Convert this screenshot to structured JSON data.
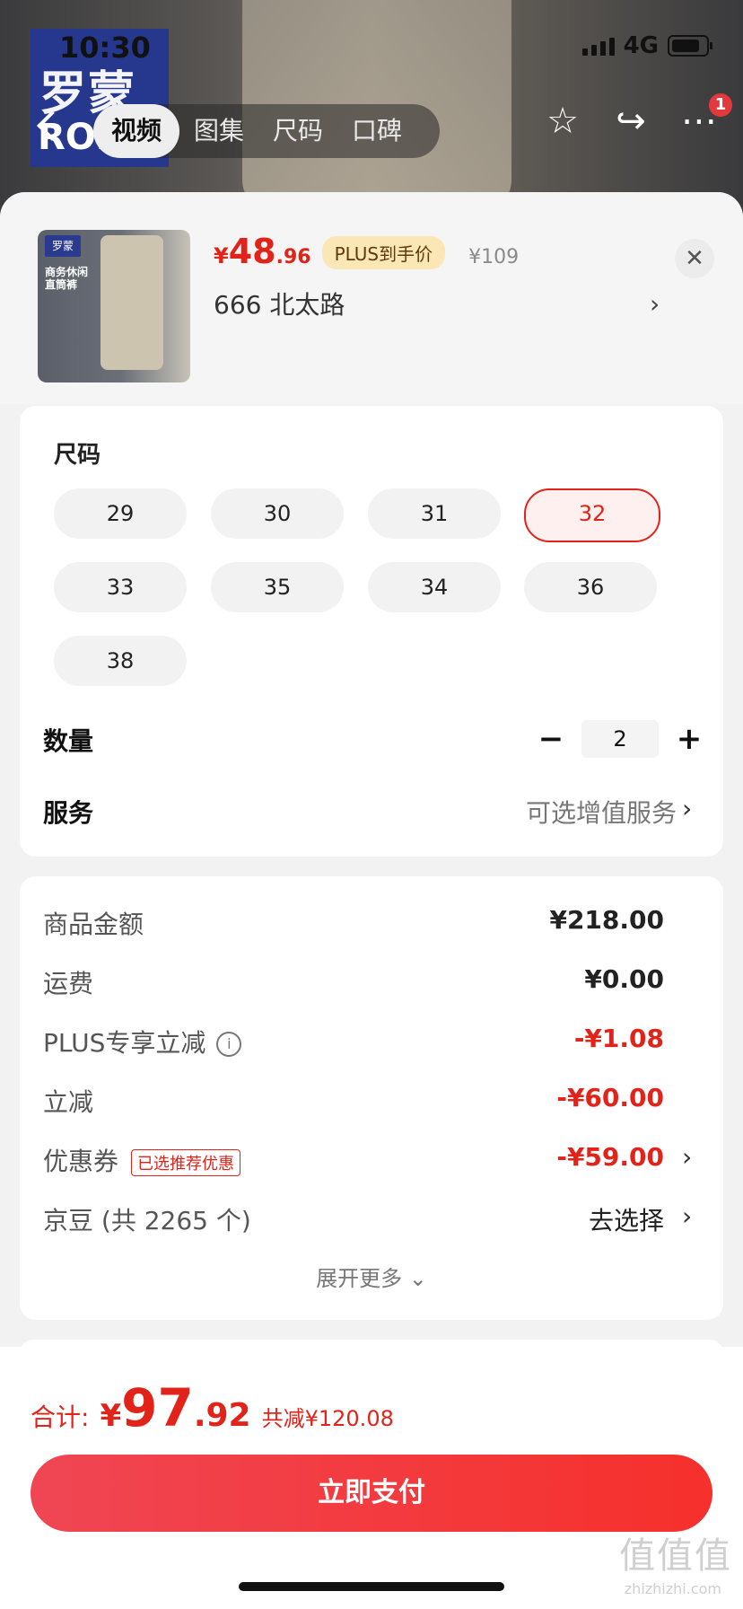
{
  "status_bar": {
    "time": "10:30",
    "network": "4G"
  },
  "header": {
    "brand_logo_cn": "罗蒙",
    "brand_logo_en": "ROM",
    "media_tabs": [
      "视频",
      "图集",
      "尺码",
      "口碑"
    ],
    "active_tab": "视频",
    "more_badge": "1"
  },
  "product": {
    "price_symbol": "¥",
    "price_integer": "48",
    "price_decimal": ".96",
    "plus_label": "PLUS到手价",
    "original_price": "¥109",
    "selected_spec": "666  北太路",
    "thumb_tag": "罗蒙",
    "thumb_caption": "商务休闲\n直筒裤"
  },
  "size_section": {
    "title": "尺码",
    "sizes": [
      "29",
      "30",
      "31",
      "32",
      "33",
      "35",
      "34",
      "36",
      "38"
    ],
    "selected": "32"
  },
  "quantity": {
    "label": "数量",
    "value": "2",
    "minus": "−",
    "plus": "+"
  },
  "service": {
    "label": "服务",
    "value": "可选增值服务"
  },
  "fees": [
    {
      "label": "商品金额",
      "value": "¥218.00",
      "red": false
    },
    {
      "label": "运费",
      "value": "¥0.00",
      "red": false
    },
    {
      "label": "PLUS专享立减",
      "value": "-¥1.08",
      "red": true
    },
    {
      "label": "立减",
      "value": "-¥60.00",
      "red": true
    },
    {
      "label": "优惠券",
      "value": "-¥59.00",
      "red": true,
      "tag": "已选推荐优惠"
    },
    {
      "label": "京豆 (共 2265 个)",
      "value": "去选择",
      "red": false
    }
  ],
  "expand_more": "展开更多",
  "total": {
    "label": "合计:",
    "symbol": "¥",
    "integer": "97",
    "decimal": ".92",
    "discount": "共减¥120.08"
  },
  "pay_button": "立即支付",
  "watermark": {
    "main": "值值值",
    "sub": "zhizhizhi.com"
  },
  "colors": {
    "accent_red": "#e2231a",
    "plus_gold": "#fbe7b5",
    "brand_blue": "#26378e"
  }
}
